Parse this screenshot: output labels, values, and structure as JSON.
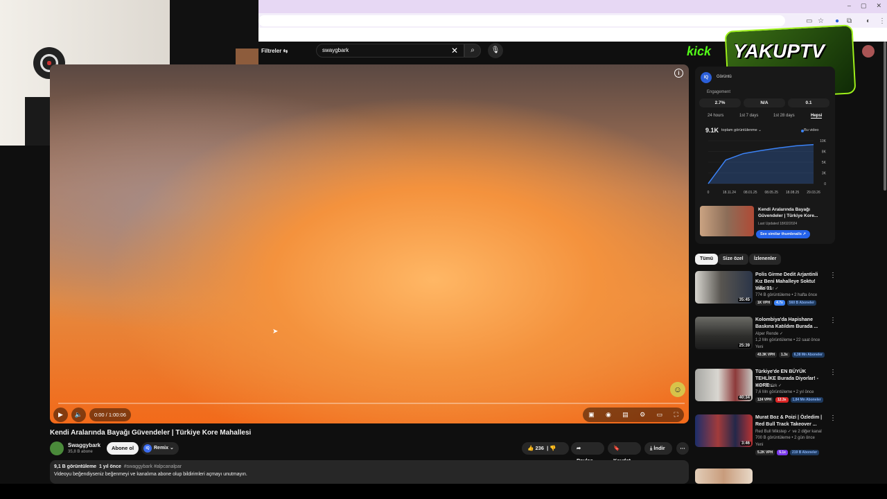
{
  "webcam": {
    "logo": "logi"
  },
  "browser": {
    "window_controls": [
      "–",
      "▢",
      "✕"
    ]
  },
  "masthead": {
    "filters_label": "Filtreler",
    "search_value": "swaygbark",
    "kick_logo": "kick",
    "overlay_logo": "YAKUPTV"
  },
  "player": {
    "time": "0:00 / 1:00:06",
    "progress": 0
  },
  "video": {
    "title": "Kendi Aralarında Bayağı Güvendeler | Türkiye Kore Mahallesi",
    "channel": "Swaggybark",
    "subscribers": "35,8 B abone",
    "subscribe_label": "Abone ol",
    "remix_label": "Remix",
    "likes": "236",
    "share_label": "Paylaş",
    "save_label": "Kaydet",
    "download_label": "İndir",
    "views": "9,1 B görüntüleme",
    "age": "1 yıl önce",
    "tags": "#swaggybark #alpcanalpar",
    "description": "Videoyu beğendiyseniz beğenmeyi ve kanalıma abone olup bildirimleri açmayı unutmayın."
  },
  "analytics": {
    "badge": "IQ",
    "header_label": "Görüntü",
    "engagement_label": "Engagement",
    "metrics": [
      "2.7%",
      "N/A",
      "0.1"
    ],
    "ranges": [
      "24 hours",
      "1st 7 days",
      "1st 28 days",
      "Hepsi"
    ],
    "total_views": "9.1K",
    "views_select": "toplam görüntülenme ⌄",
    "legend": "Bu video",
    "thumb_title": "Kendi Aralarında Bayağı Güvendeler | Türkiye Kore...",
    "thumb_updated": "Last Updated 18/02/2024",
    "similar_label": "See similar thumbnails ↗"
  },
  "chart_data": {
    "type": "line",
    "x": [
      "0",
      "18.11.24",
      "08.01.25",
      "08.05.25",
      "18.08.25",
      "29.03.26"
    ],
    "y_ticks": [
      "10K",
      "8K",
      "5K",
      "3K",
      "0"
    ],
    "series": [
      {
        "values": [
          0,
          5500,
          7000,
          7700,
          8300,
          8800,
          9100
        ]
      }
    ],
    "ylim": [
      0,
      10000
    ]
  },
  "chips": [
    "Tümü",
    "Size özel",
    "İzlenenler"
  ],
  "recommended": [
    {
      "title": "Polis Girme Dedit Arjantinli Kız Beni Mahalleye Soktu! Villa 31",
      "channel": "Ardı Pazır ✓",
      "meta": "774 B görüntüleme • 2 hafta önce",
      "duration": "35:45",
      "badges": [
        "1K VPH",
        "4.7x",
        "560 B Aboneler"
      ]
    },
    {
      "title": "Kolombiya'da Hapishane Baskına Katıldım Burada ...",
      "channel": "Alper Rende ✓",
      "meta": "1,2 Mn görüntüleme • 22 saat önce",
      "new": "Yeni",
      "duration": "25:39",
      "badges": [
        "43.3K VPH",
        "1.3x",
        "6,38 Mn Aboneler"
      ]
    },
    {
      "title": "Türkiye'de EN BÜYÜK TEHLİKE Burada Diyorlar! - KORE ...",
      "channel": "Mert Öztürk ✓",
      "meta": "7,6 Mn görüntüleme • 2 yıl önce",
      "duration": "40:34",
      "badges": [
        "124 VPH",
        "12.3x",
        "1,84 Mn Aboneler"
      ]
    },
    {
      "title": "Murat Boz & Poizi | Özledim | Red Bull Track Takeover ...",
      "channel": "Red Bull Mikstep ✓ ve 2 diğer kanal",
      "meta": "700 B görüntüleme • 2 gün önce",
      "new": "Yeni",
      "duration": "3:46",
      "badges": [
        "5.2K VPH",
        "5.1x",
        "219 B Aboneler"
      ]
    }
  ]
}
